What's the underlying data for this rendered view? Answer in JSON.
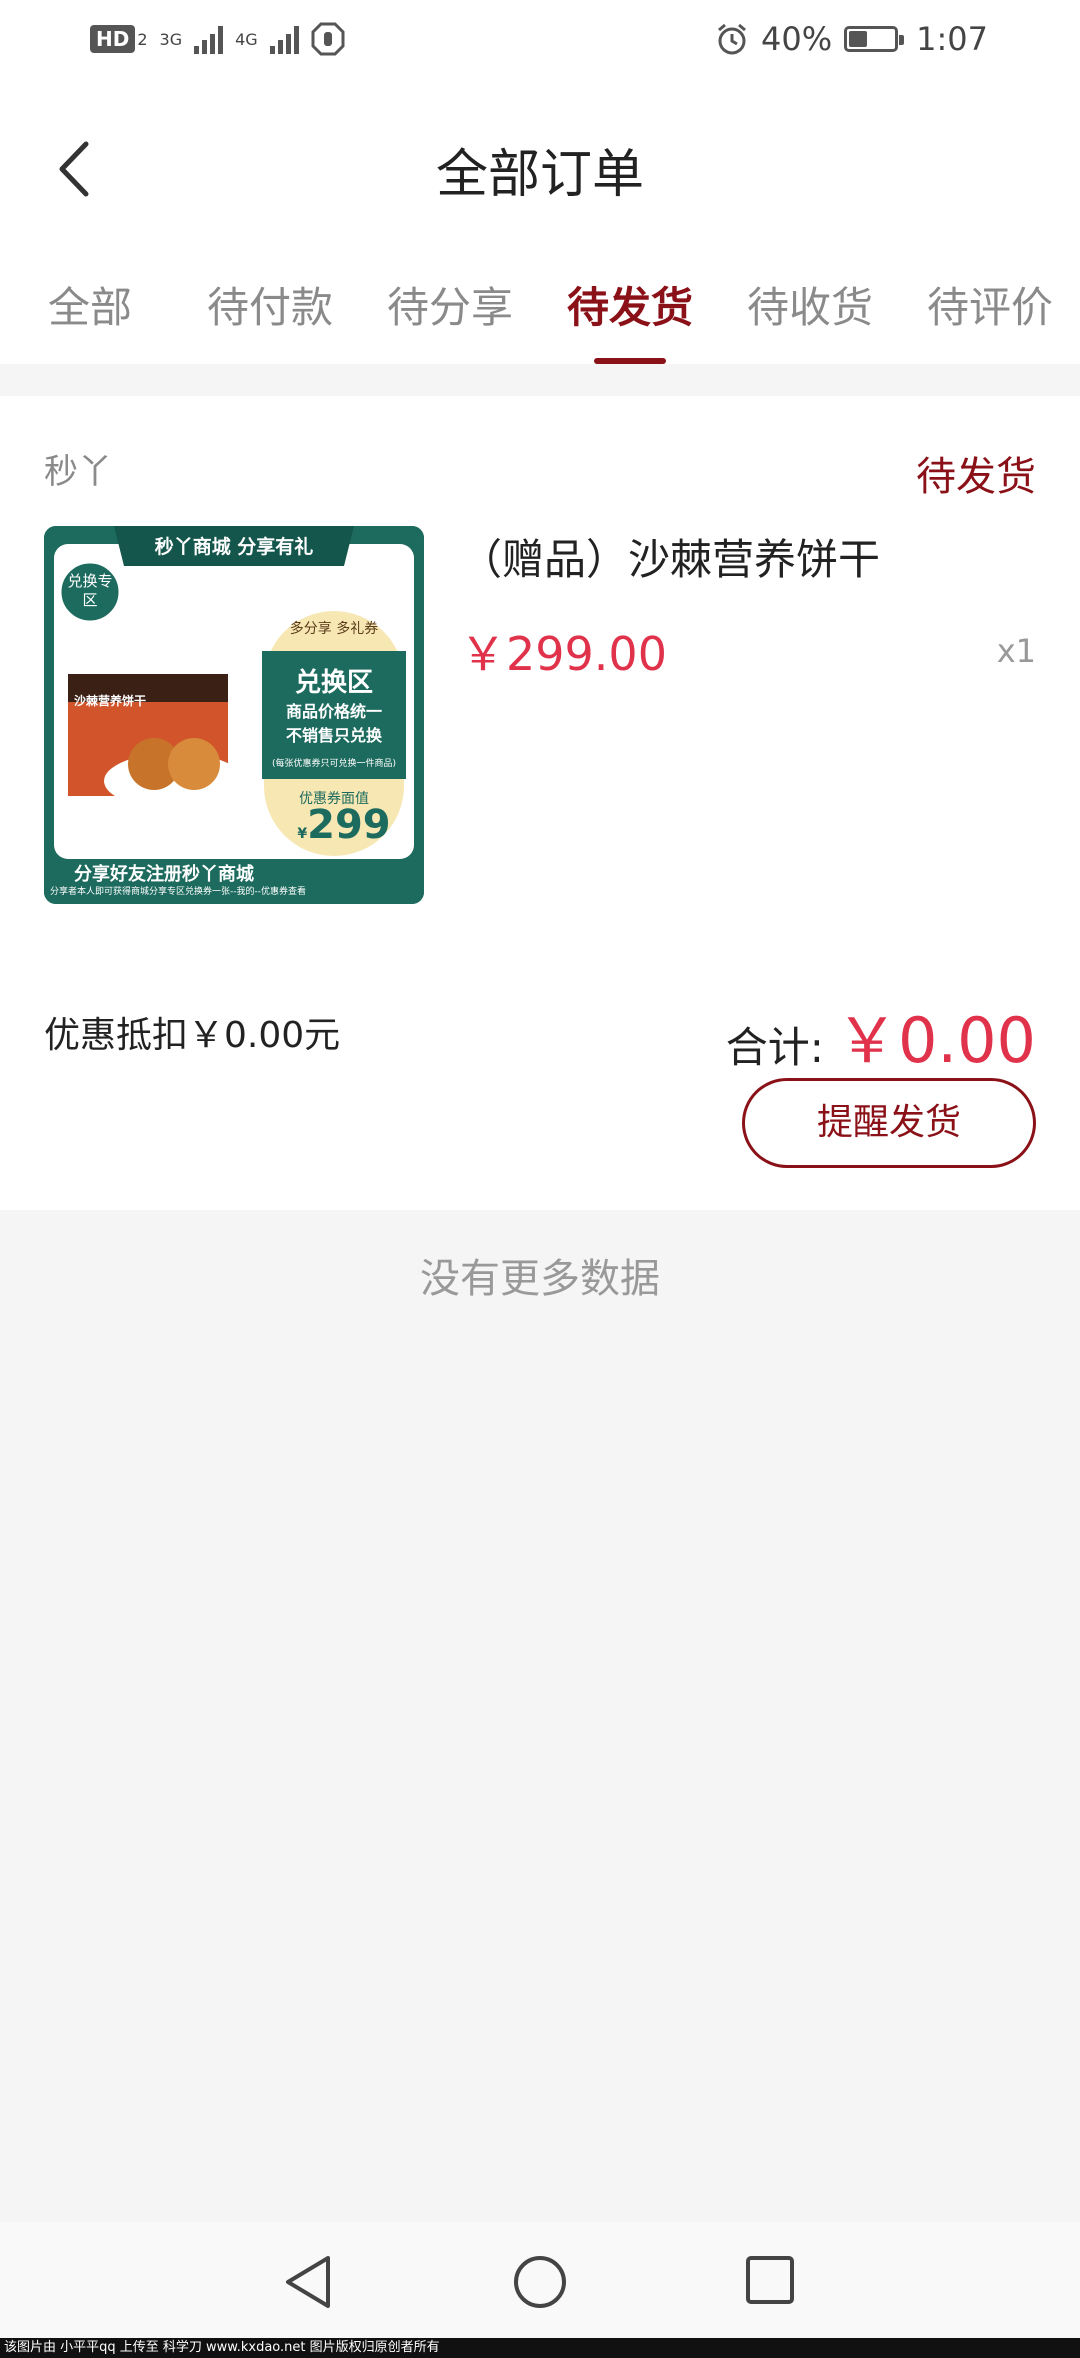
{
  "status_bar": {
    "hd_label": "HD",
    "hd_sub": "2",
    "net1": "3G",
    "net2": "4G",
    "battery_text": "40%",
    "battery_level": 0.4,
    "time": "1:07"
  },
  "header": {
    "title": "全部订单"
  },
  "tabs": [
    {
      "label": "全部"
    },
    {
      "label": "待付款"
    },
    {
      "label": "待分享"
    },
    {
      "label": "待发货"
    },
    {
      "label": "待收货"
    },
    {
      "label": "待评价"
    }
  ],
  "active_tab": "待发货",
  "order": {
    "shop_name": "秒丫",
    "status": "待发货",
    "product_name": "（赠品）沙棘营养饼干",
    "price": "￥299.00",
    "quantity": "x1",
    "discount_text": "优惠抵扣￥0.00元",
    "total_label": "合计:",
    "total_amount": "￥0.00",
    "remind_button": "提醒发货",
    "image": {
      "banner": "秒丫商城  分享有礼",
      "corner_badge": "兑换专区",
      "pill_top": "多分享 多礼券",
      "zone_title": "兑换区",
      "zone_line1": "商品价格统一",
      "zone_line2": "不销售只兑换",
      "zone_note": "(每张优惠券只可兑换一件商品)",
      "coupon_label": "优惠券面值",
      "coupon_currency": "¥",
      "coupon_value": "299",
      "bottom_line1": "分享好友注册秒丫商城",
      "bottom_line2": "分享者本人即可获得商城分享专区兑换券一张--我的--优惠券查看",
      "box_text": "沙棘营养饼干"
    }
  },
  "no_more": "没有更多数据",
  "footer_text": "该图片由 小平平qq 上传至 科学刀 www.kxdao.net 图片版权归原创者所有",
  "colors": {
    "accent": "#8b1118",
    "price": "#e0324a",
    "muted": "#8a8a8a"
  }
}
